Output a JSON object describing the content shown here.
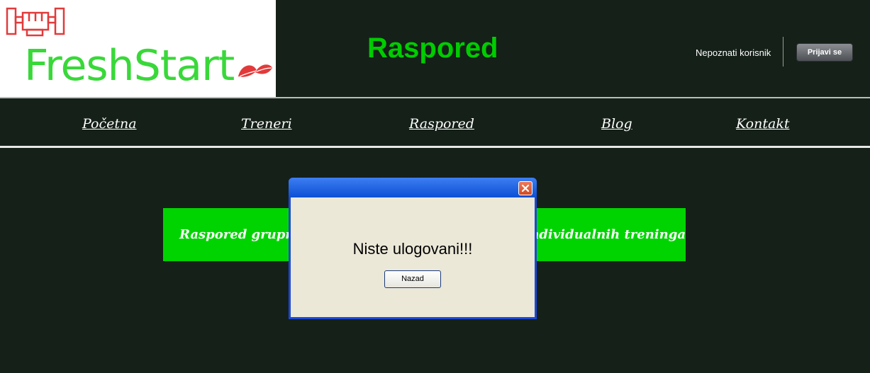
{
  "header": {
    "logo_text": "FreshStart",
    "logo_icon": "fist-logo-icon",
    "leaf_icon": "leaf-icon",
    "page_title": "Raspored",
    "user_label": "Nepoznati korisnik",
    "login_label": "Prijavi se"
  },
  "nav": {
    "items": [
      {
        "label": "Početna"
      },
      {
        "label": "Treneri"
      },
      {
        "label": "Raspored"
      },
      {
        "label": "Blog"
      },
      {
        "label": "Kontakt"
      }
    ]
  },
  "main": {
    "group_button_label": "Raspored grupnih treninga",
    "individual_button_label": "Raspored individualnih treninga"
  },
  "dialog": {
    "message": "Niste ulogovani!!!",
    "button_label": "Nazad",
    "close_icon": "close-icon"
  },
  "colors": {
    "background": "#152019",
    "accent_green": "#00d400",
    "title_green": "#00cc00",
    "logo_red": "#e23a3a",
    "dialog_blue": "#1c48d8"
  }
}
